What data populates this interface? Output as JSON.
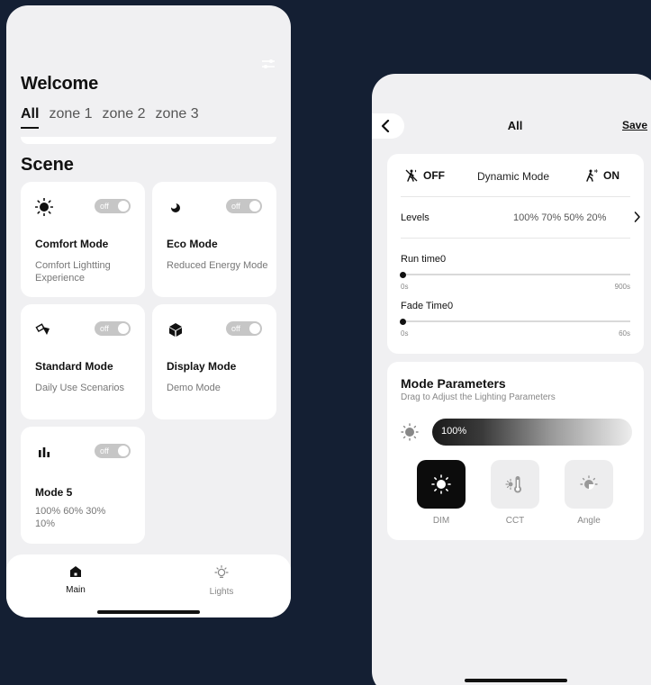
{
  "left_screen": {
    "welcome_title": "Welcome",
    "zones": [
      "All",
      "zone 1",
      "zone 2",
      "zone 3"
    ],
    "scene_title": "Scene",
    "scenes": [
      {
        "icon": "sun-icon",
        "name": "Comfort Mode",
        "desc": "Comfort Lightting Experience",
        "toggle": "off"
      },
      {
        "icon": "moon-icon",
        "name": "Eco Mode",
        "desc": "Reduced Energy Mode",
        "toggle": "off"
      },
      {
        "icon": "spotlight-icon",
        "name": "Standard Mode",
        "desc": "Daily Use Scenarios",
        "toggle": "off"
      },
      {
        "icon": "cube-icon",
        "name": "Display Mode",
        "desc": "Demo Mode",
        "toggle": "off"
      },
      {
        "icon": "bar-chart-icon",
        "name": "Mode 5",
        "desc": "100% 60% 30% 10%",
        "toggle": "off"
      }
    ],
    "nav": [
      {
        "icon": "home-icon",
        "label": "Main"
      },
      {
        "icon": "lightbulb-icon",
        "label": "Lights"
      }
    ]
  },
  "right_screen": {
    "title": "All",
    "save_label": "Save",
    "dynamic": {
      "off_label": "OFF",
      "mode_label": "Dynamic Mode",
      "on_label": "ON"
    },
    "levels": {
      "label": "Levels",
      "value": "100% 70% 50% 20%"
    },
    "run_time": {
      "label": "Run time0",
      "min": "0s",
      "max": "900s",
      "value": 0
    },
    "fade_time": {
      "label": "Fade Time0",
      "min": "0s",
      "max": "60s",
      "value": 0
    },
    "mode_params": {
      "title": "Mode Parameters",
      "subtitle": "Drag to Adjust the Lighting Parameters",
      "brightness": "100%",
      "modes": [
        {
          "icon": "sun-icon",
          "label": "DIM",
          "active": true
        },
        {
          "icon": "thermometer-icon",
          "label": "CCT",
          "active": false
        },
        {
          "icon": "angle-icon",
          "label": "Angle",
          "active": false
        }
      ]
    }
  },
  "colors": {
    "background": "#141f33",
    "screen": "#f0f0f2",
    "card": "#ffffff",
    "toggle_off": "#c6c6c6",
    "active_button": "#0c0c0c"
  }
}
